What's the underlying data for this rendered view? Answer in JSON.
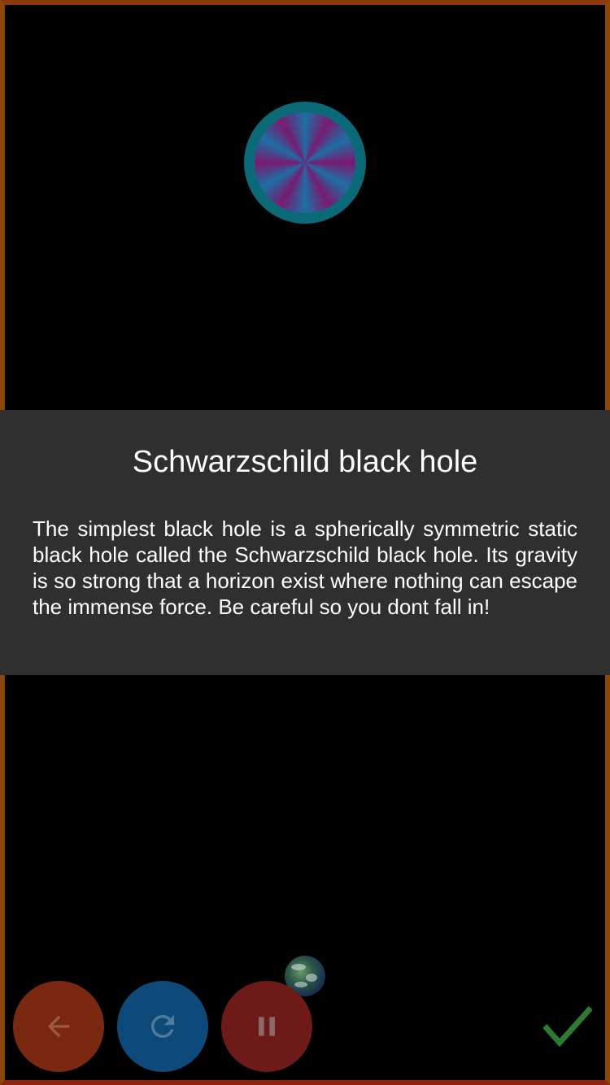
{
  "info": {
    "title": "Schwarzschild black hole",
    "body": "The simplest black hole is a spherically symmetric static black hole called the Schwarzschild black hole. Its gravity is so strong that a horizon exist where nothing can escape the immense force. Be careful so you dont fall in!"
  },
  "controls": {
    "back_icon": "arrow-left-icon",
    "restart_icon": "restart-icon",
    "pause_icon": "pause-icon",
    "confirm_icon": "checkmark-icon"
  },
  "colors": {
    "frame": "#8a4a06",
    "panel_background": "#2f2f2f",
    "back_button": "#7a2810",
    "restart_button": "#0d4a7a",
    "pause_button": "#6e1a18",
    "confirm": "#2e7a32",
    "black_hole_ring": "#0b6a78"
  }
}
